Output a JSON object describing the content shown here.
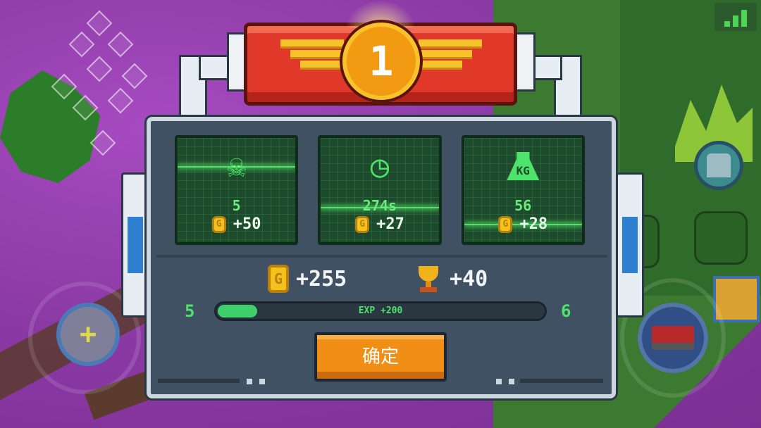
{
  "rank": "1",
  "stats": [
    {
      "icon": "skull-icon",
      "value": "5",
      "reward": "+50"
    },
    {
      "icon": "clock-icon",
      "value": "274s",
      "reward": "+27"
    },
    {
      "icon": "weight-icon",
      "icon_text": "KG",
      "value": "56",
      "reward": "+28"
    }
  ],
  "totals": {
    "coins": "+255",
    "trophies": "+40"
  },
  "coin_symbol": "G",
  "exp": {
    "level_current": "5",
    "level_next": "6",
    "label": "EXP +200",
    "progress": 0.12
  },
  "confirm_label": "确定",
  "colors": {
    "accent_green": "#4ee36a",
    "button_orange": "#f08e15",
    "banner_red": "#e0392a"
  }
}
